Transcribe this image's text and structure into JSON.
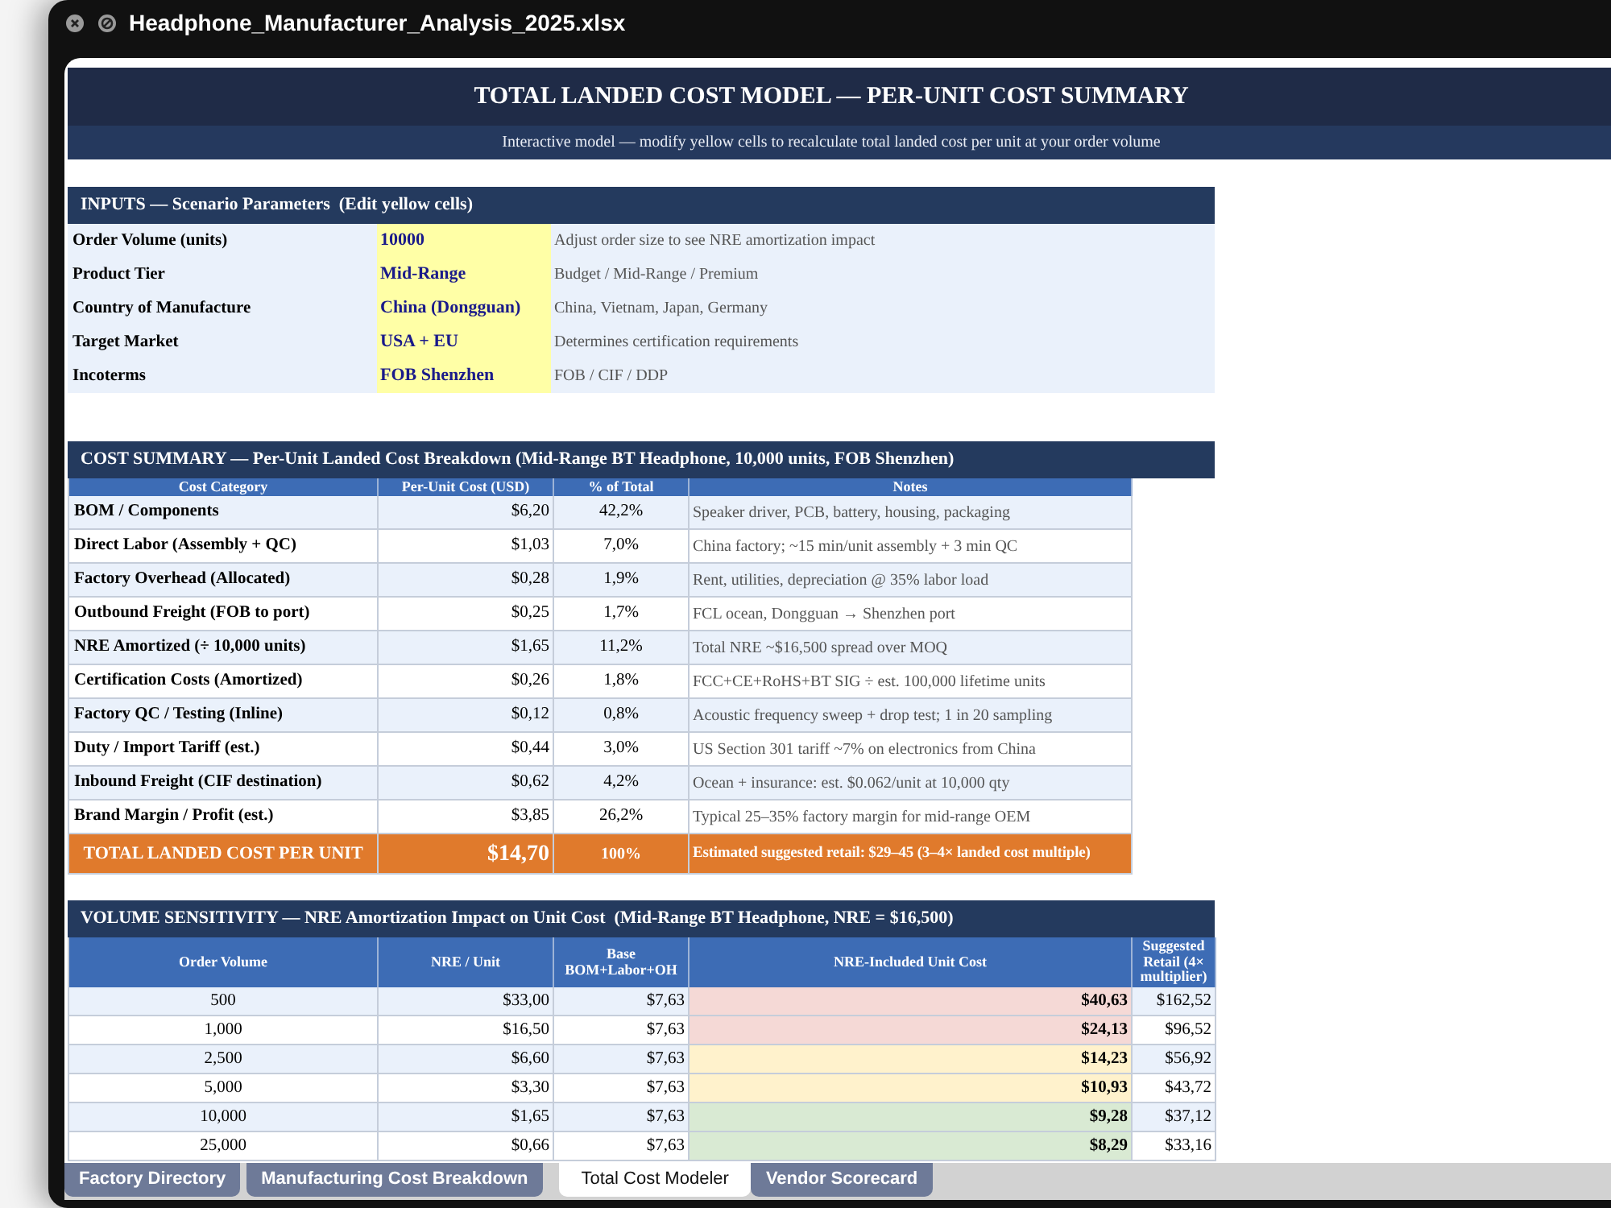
{
  "window": {
    "title": "Headphone_Manufacturer_Analysis_2025.xlsx"
  },
  "sheet": {
    "title": "TOTAL LANDED COST MODEL — PER-UNIT COST SUMMARY",
    "subtitle": "Interactive model — modify yellow cells to recalculate total landed cost per unit at your order volume"
  },
  "inputs": {
    "heading": "INPUTS — Scenario Parameters  (Edit yellow cells)",
    "rows": [
      {
        "label": "Order Volume (units)",
        "value": "10000",
        "note": "Adjust order size to see NRE amortization impact"
      },
      {
        "label": "Product Tier",
        "value": "Mid-Range",
        "note": "Budget / Mid-Range / Premium"
      },
      {
        "label": "Country of Manufacture",
        "value": "China (Dongguan)",
        "note": "China, Vietnam, Japan, Germany"
      },
      {
        "label": "Target Market",
        "value": "USA + EU",
        "note": "Determines certification requirements"
      },
      {
        "label": "Incoterms",
        "value": "FOB Shenzhen",
        "note": "FOB / CIF / DDP"
      }
    ]
  },
  "cost_summary": {
    "heading": "COST SUMMARY — Per-Unit Landed Cost Breakdown (Mid-Range BT Headphone, 10,000 units, FOB Shenzhen)",
    "columns": [
      "Cost Category",
      "Per-Unit Cost (USD)",
      "% of Total",
      "Notes"
    ],
    "rows": [
      {
        "category": "BOM / Components",
        "cost": "$6,20",
        "share": "42,2%",
        "note": "Speaker driver, PCB, battery, housing, packaging"
      },
      {
        "category": "Direct Labor (Assembly + QC)",
        "cost": "$1,03",
        "share": "7,0%",
        "note": "China factory; ~15 min/unit assembly + 3 min QC"
      },
      {
        "category": "Factory Overhead (Allocated)",
        "cost": "$0,28",
        "share": "1,9%",
        "note": "Rent, utilities, depreciation @ 35% labor load"
      },
      {
        "category": "Outbound Freight (FOB to port)",
        "cost": "$0,25",
        "share": "1,7%",
        "note": "FCL ocean, Dongguan → Shenzhen port"
      },
      {
        "category": "NRE Amortized (÷ 10,000 units)",
        "cost": "$1,65",
        "share": "11,2%",
        "note": "Total NRE ~$16,500 spread over MOQ"
      },
      {
        "category": "Certification Costs (Amortized)",
        "cost": "$0,26",
        "share": "1,8%",
        "note": "FCC+CE+RoHS+BT SIG ÷ est. 100,000 lifetime units"
      },
      {
        "category": "Factory QC / Testing (Inline)",
        "cost": "$0,12",
        "share": "0,8%",
        "note": "Acoustic frequency sweep + drop test; 1 in 20 sampling"
      },
      {
        "category": "Duty / Import Tariff (est.)",
        "cost": "$0,44",
        "share": "3,0%",
        "note": "US Section 301 tariff ~7% on electronics from China"
      },
      {
        "category": "Inbound Freight (CIF destination)",
        "cost": "$0,62",
        "share": "4,2%",
        "note": "Ocean + insurance: est. $0.062/unit at 10,000 qty"
      },
      {
        "category": "Brand Margin / Profit (est.)",
        "cost": "$3,85",
        "share": "26,2%",
        "note": "Typical 25–35% factory margin for mid-range OEM"
      }
    ],
    "total": {
      "category": "TOTAL LANDED COST PER UNIT",
      "cost": "$14,70",
      "share": "100%",
      "note": "Estimated suggested retail: $29–45 (3–4× landed cost multiple)"
    }
  },
  "volume_sensitivity": {
    "heading": "VOLUME SENSITIVITY — NRE Amortization Impact on Unit Cost  (Mid-Range BT Headphone, NRE = $16,500)",
    "columns": [
      "Order Volume",
      "NRE / Unit",
      "Base BOM+Labor+OH",
      "NRE-Included Unit Cost",
      "Suggested Retail (4× multiplier)"
    ],
    "rows": [
      {
        "volume": "500",
        "nre_per_unit": "$33,00",
        "base": "$7,63",
        "unit_cost": "$40,63",
        "retail": "$162,52",
        "color": "#f5d9d6"
      },
      {
        "volume": "1,000",
        "nre_per_unit": "$16,50",
        "base": "$7,63",
        "unit_cost": "$24,13",
        "retail": "$96,52",
        "color": "#f5d9d6"
      },
      {
        "volume": "2,500",
        "nre_per_unit": "$6,60",
        "base": "$7,63",
        "unit_cost": "$14,23",
        "retail": "$56,92",
        "color": "#fff2cc"
      },
      {
        "volume": "5,000",
        "nre_per_unit": "$3,30",
        "base": "$7,63",
        "unit_cost": "$10,93",
        "retail": "$43,72",
        "color": "#fff2cc"
      },
      {
        "volume": "10,000",
        "nre_per_unit": "$1,65",
        "base": "$7,63",
        "unit_cost": "$9,28",
        "retail": "$37,12",
        "color": "#d9ead3"
      },
      {
        "volume": "25,000",
        "nre_per_unit": "$0,66",
        "base": "$7,63",
        "unit_cost": "$8,29",
        "retail": "$33,16",
        "color": "#d9ead3"
      }
    ]
  },
  "sheet_tabs": [
    {
      "label": "Factory Directory",
      "selected": false
    },
    {
      "label": "Manufacturing Cost Breakdown",
      "selected": false
    },
    {
      "label": "Total Cost Modeler",
      "selected": true
    },
    {
      "label": "Vendor Scorecard",
      "selected": false
    }
  ]
}
